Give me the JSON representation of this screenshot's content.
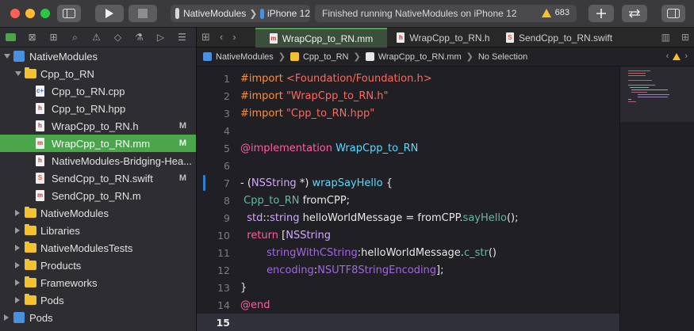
{
  "toolbar": {
    "scheme": "NativeModules",
    "device": "iPhone 12",
    "status": "Finished running NativeModules on iPhone 12",
    "warning_count": "683"
  },
  "navigator": {
    "rows": [
      {
        "label": "NativeModules",
        "kind": "project",
        "depth": 0,
        "open": true,
        "mark": ""
      },
      {
        "label": "Cpp_to_RN",
        "kind": "folder",
        "depth": 1,
        "open": true,
        "mark": ""
      },
      {
        "label": "Cpp_to_RN.cpp",
        "kind": "cpp",
        "depth": 2,
        "mark": ""
      },
      {
        "label": "Cpp_to_RN.hpp",
        "kind": "h",
        "depth": 2,
        "mark": ""
      },
      {
        "label": "WrapCpp_to_RN.h",
        "kind": "h",
        "depth": 2,
        "mark": "M"
      },
      {
        "label": "WrapCpp_to_RN.mm",
        "kind": "m",
        "depth": 2,
        "mark": "M",
        "selected": true
      },
      {
        "label": "NativeModules-Bridging-Hea...",
        "kind": "h",
        "depth": 2,
        "mark": ""
      },
      {
        "label": "SendCpp_to_RN.swift",
        "kind": "swift",
        "depth": 2,
        "mark": "M"
      },
      {
        "label": "SendCpp_to_RN.m",
        "kind": "m",
        "depth": 2,
        "mark": ""
      },
      {
        "label": "NativeModules",
        "kind": "folder",
        "depth": 1,
        "open": false,
        "mark": ""
      },
      {
        "label": "Libraries",
        "kind": "folder",
        "depth": 1,
        "open": false,
        "mark": ""
      },
      {
        "label": "NativeModulesTests",
        "kind": "folder",
        "depth": 1,
        "open": false,
        "mark": ""
      },
      {
        "label": "Products",
        "kind": "folder",
        "depth": 1,
        "open": false,
        "mark": ""
      },
      {
        "label": "Frameworks",
        "kind": "folder",
        "depth": 1,
        "open": false,
        "mark": ""
      },
      {
        "label": "Pods",
        "kind": "folder",
        "depth": 1,
        "open": false,
        "mark": ""
      },
      {
        "label": "Pods",
        "kind": "project",
        "depth": 0,
        "open": false,
        "mark": ""
      }
    ]
  },
  "tabs": [
    {
      "label": "WrapCpp_to_RN.mm",
      "icon": "m",
      "active": true
    },
    {
      "label": "WrapCpp_to_RN.h",
      "icon": "h",
      "active": false
    },
    {
      "label": "SendCpp_to_RN.swift",
      "icon": "swift",
      "active": false
    }
  ],
  "jumpbar": {
    "items": [
      "NativeModules",
      "Cpp_to_RN",
      "WrapCpp_to_RN.mm",
      "No Selection"
    ]
  },
  "code": {
    "current_line": 15,
    "changed_line": 7,
    "lines": [
      {
        "n": "1",
        "tokens": [
          [
            "k-pre",
            "#import "
          ],
          [
            "k-str",
            "<Foundation/Foundation.h>"
          ]
        ]
      },
      {
        "n": "2",
        "tokens": [
          [
            "k-pre",
            "#import "
          ],
          [
            "k-str",
            "\"WrapCpp_to_RN.h\""
          ]
        ]
      },
      {
        "n": "3",
        "tokens": [
          [
            "k-pre",
            "#import "
          ],
          [
            "k-str",
            "\"Cpp_to_RN.hpp\""
          ]
        ]
      },
      {
        "n": "4",
        "tokens": []
      },
      {
        "n": "5",
        "tokens": [
          [
            "k-kw",
            "@implementation "
          ],
          [
            "k-cls",
            "WrapCpp_to_RN"
          ]
        ]
      },
      {
        "n": "6",
        "tokens": []
      },
      {
        "n": "7",
        "tokens": [
          [
            "k-plain",
            "- ("
          ],
          [
            "k-type",
            "NSString"
          ],
          [
            "k-plain",
            " *) "
          ],
          [
            "k-cls",
            "wrapSayHello"
          ],
          [
            "k-plain",
            " {"
          ]
        ]
      },
      {
        "n": "8",
        "tokens": [
          [
            "k-plain",
            " "
          ],
          [
            "k-meth",
            "Cpp_to_RN"
          ],
          [
            "k-plain",
            " fromCPP;"
          ]
        ]
      },
      {
        "n": "9",
        "tokens": [
          [
            "k-plain",
            "  "
          ],
          [
            "k-type",
            "std"
          ],
          [
            "k-plain",
            "::"
          ],
          [
            "k-type",
            "string"
          ],
          [
            "k-plain",
            " helloWorldMessage = fromCPP."
          ],
          [
            "k-meth",
            "sayHello"
          ],
          [
            "k-plain",
            "();"
          ]
        ]
      },
      {
        "n": "10",
        "tokens": [
          [
            "k-plain",
            "  "
          ],
          [
            "k-kw",
            "return"
          ],
          [
            "k-plain",
            " ["
          ],
          [
            "k-type",
            "NSString"
          ]
        ]
      },
      {
        "n": "11",
        "tokens": [
          [
            "k-plain",
            "        "
          ],
          [
            "k-fn",
            "stringWithCString"
          ],
          [
            "k-plain",
            ":helloWorldMessage."
          ],
          [
            "k-meth",
            "c_str"
          ],
          [
            "k-plain",
            "()"
          ]
        ]
      },
      {
        "n": "12",
        "tokens": [
          [
            "k-plain",
            "        "
          ],
          [
            "k-fn",
            "encoding"
          ],
          [
            "k-plain",
            ":"
          ],
          [
            "k-fn",
            "NSUTF8StringEncoding"
          ],
          [
            "k-plain",
            "];"
          ]
        ]
      },
      {
        "n": "13",
        "tokens": [
          [
            "k-plain",
            "}"
          ]
        ]
      },
      {
        "n": "14",
        "tokens": [
          [
            "k-kw",
            "@end"
          ]
        ]
      },
      {
        "n": "15",
        "tokens": []
      }
    ]
  }
}
